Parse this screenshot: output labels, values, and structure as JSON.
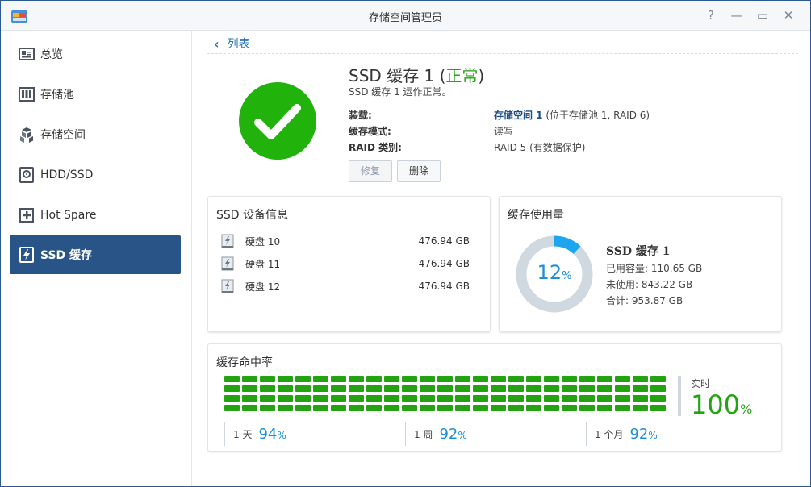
{
  "window": {
    "title": "存储空间管理员",
    "controls": [
      {
        "name": "help-icon",
        "glyph": "?"
      },
      {
        "name": "minimize-icon",
        "glyph": "—"
      },
      {
        "name": "maximize-icon",
        "glyph": "▭"
      },
      {
        "name": "close-icon",
        "glyph": "✕"
      }
    ]
  },
  "sidebar": {
    "items": [
      {
        "label": "总览",
        "icon": "overview-icon",
        "active": false
      },
      {
        "label": "存储池",
        "icon": "storage-pool-icon",
        "active": false
      },
      {
        "label": "存储空间",
        "icon": "volume-icon",
        "active": false
      },
      {
        "label": "HDD/SSD",
        "icon": "disk-icon",
        "active": false
      },
      {
        "label": "Hot Spare",
        "icon": "hot-spare-icon",
        "active": false
      },
      {
        "label": "SSD 缓存",
        "icon": "ssd-cache-icon",
        "active": true
      }
    ]
  },
  "main": {
    "back_label": "列表",
    "header": {
      "title_prefix": "SSD 缓存 1 (",
      "status": "正常",
      "title_suffix": ")",
      "subtitle": "SSD 缓存 1 运作正常。",
      "rows": [
        {
          "key": "装载:",
          "value_bold": "存储空间 1",
          "value": " (位于存储池 1, RAID 6)"
        },
        {
          "key": "缓存模式:",
          "value_bold": "",
          "value": "读写"
        },
        {
          "key": "RAID 类别:",
          "value_bold": "",
          "value": "RAID 5 (有数据保护)"
        }
      ],
      "buttons": {
        "repair": "修复",
        "delete": "删除"
      }
    },
    "devices": {
      "title": "SSD 设备信息",
      "list": [
        {
          "name": "硬盘 10",
          "size": "476.94 GB"
        },
        {
          "name": "硬盘 11",
          "size": "476.94 GB"
        },
        {
          "name": "硬盘 12",
          "size": "476.94 GB"
        }
      ]
    },
    "usage": {
      "title": "缓存使用量",
      "percent": "12",
      "percent_unit": "%",
      "percent_value": 0.12,
      "name": "SSD 缓存 1",
      "used": "已用容量: 110.65 GB",
      "free": "未使用: 843.22 GB",
      "total": "合计: 953.87 GB",
      "colors": {
        "used": "#1ea5f0",
        "free": "#d0d8e0"
      }
    },
    "hit_rate": {
      "title": "缓存命中率",
      "realtime_label": "实时",
      "realtime_value": "100",
      "unit": "%",
      "grid_color": "#22a30f",
      "periods": [
        {
          "label": "1 天",
          "value": "94"
        },
        {
          "label": "1 周",
          "value": "92"
        },
        {
          "label": "1 个月",
          "value": "92"
        }
      ]
    }
  }
}
